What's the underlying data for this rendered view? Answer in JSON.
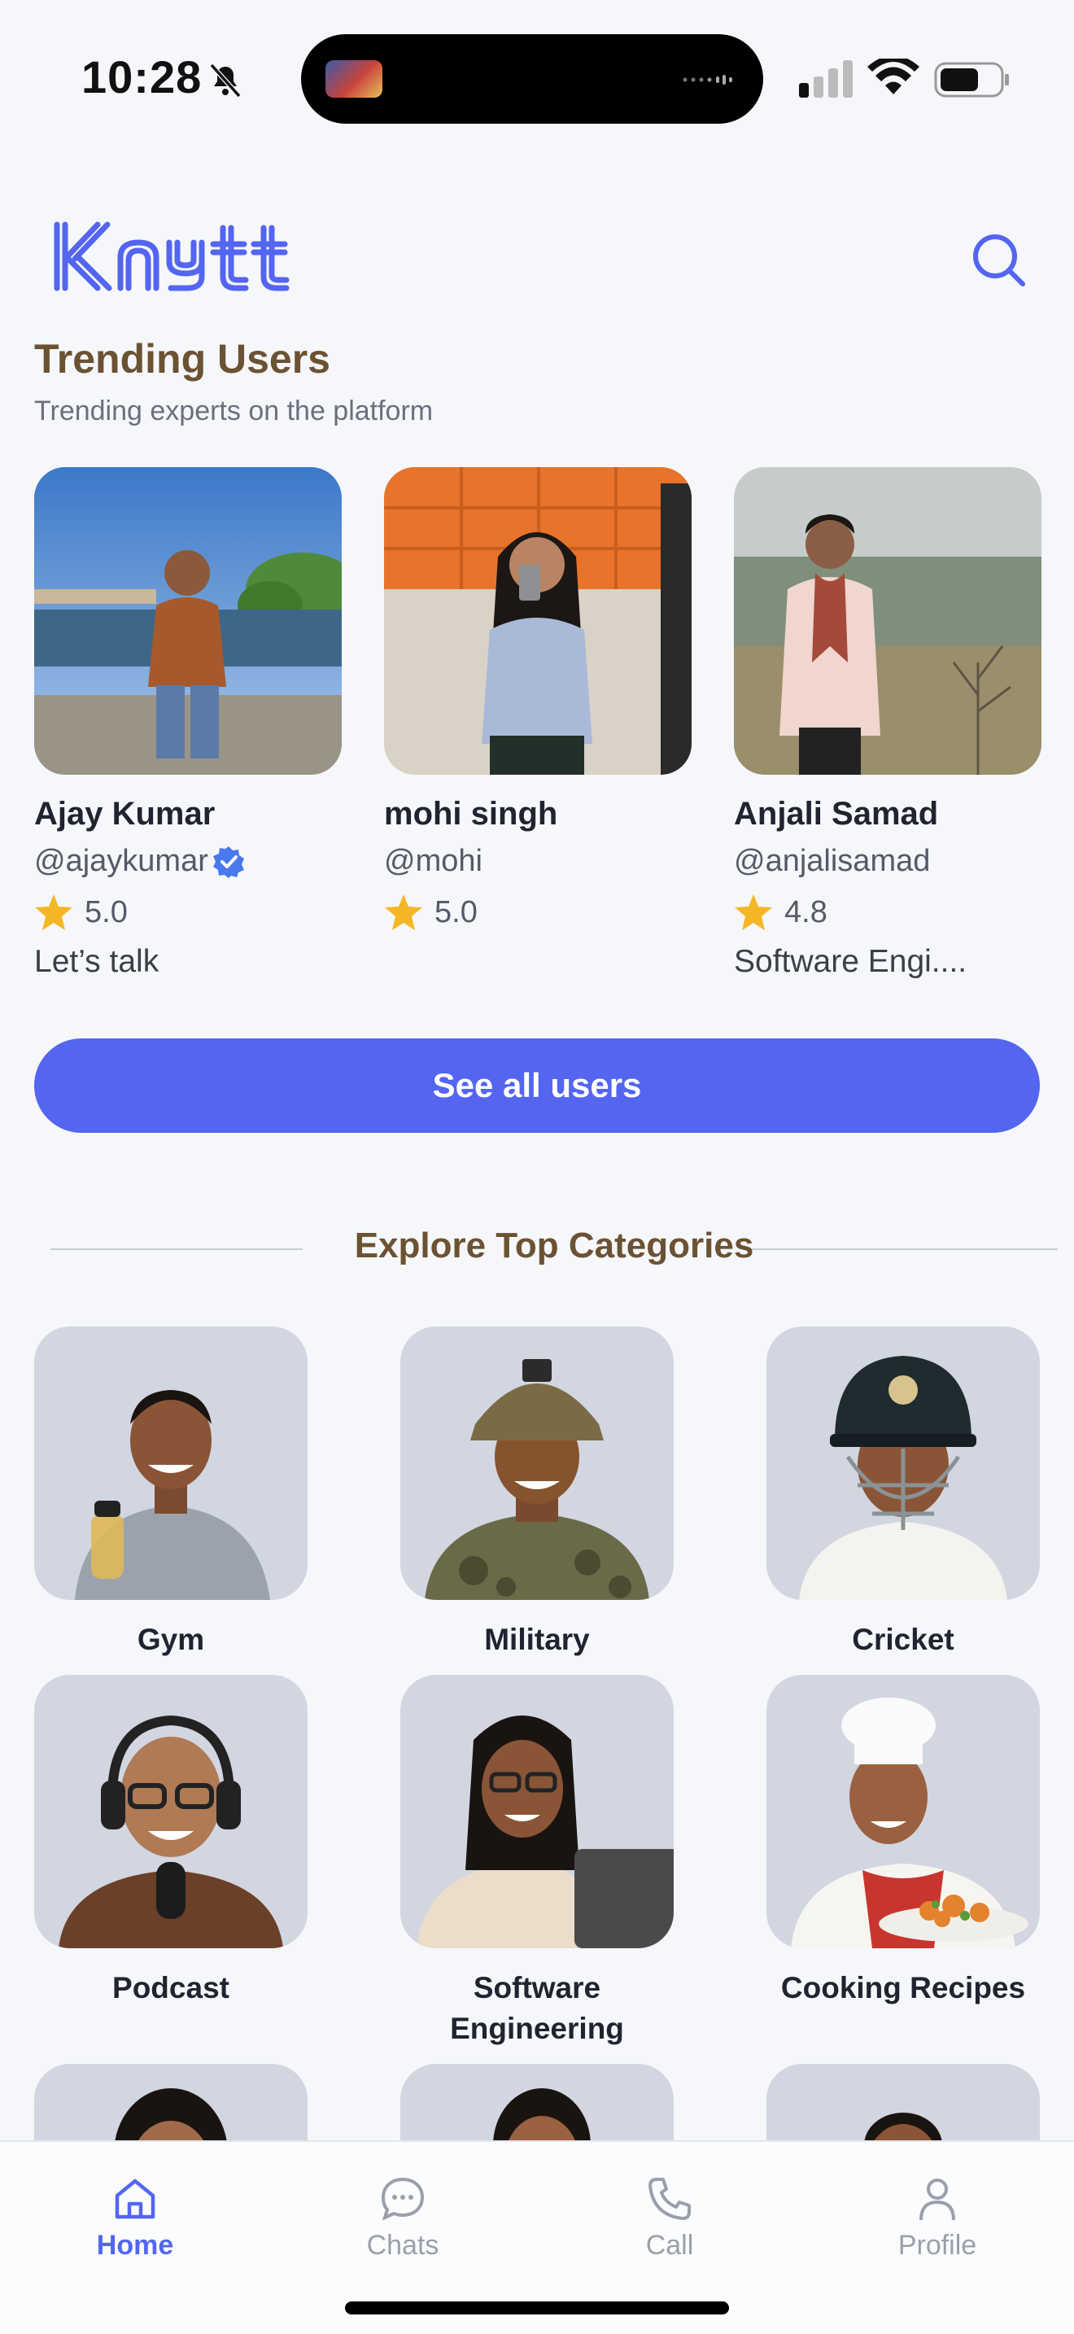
{
  "status_bar": {
    "time": "10:28"
  },
  "app": {
    "logo_text": "knytt",
    "accent": "#5465f0",
    "title_color": "#6b5232"
  },
  "trending": {
    "title": "Trending Users",
    "subtitle": "Trending experts on the platform",
    "users": [
      {
        "name": "Ajay Kumar",
        "handle": "@ajaykumar",
        "verified": true,
        "rating": "5.0",
        "bio": "Let’s talk"
      },
      {
        "name": "mohi singh",
        "handle": "@mohi",
        "verified": false,
        "rating": "5.0",
        "bio": ""
      },
      {
        "name": "Anjali Samad",
        "handle": "@anjalisamad",
        "verified": false,
        "rating": "4.8",
        "bio": "Software Engi...."
      }
    ],
    "see_all_label": "See all users"
  },
  "categories": {
    "title": "Explore Top Categories",
    "items": [
      {
        "label": "Gym"
      },
      {
        "label": "Military"
      },
      {
        "label": "Cricket"
      },
      {
        "label": "Podcast"
      },
      {
        "label": "Software Engineering"
      },
      {
        "label": "Cooking Recipes"
      },
      {
        "label": ""
      },
      {
        "label": ""
      },
      {
        "label": ""
      }
    ]
  },
  "tabbar": {
    "tabs": [
      {
        "label": "Home",
        "icon": "home-icon",
        "active": true
      },
      {
        "label": "Chats",
        "icon": "chat-icon",
        "active": false
      },
      {
        "label": "Call",
        "icon": "phone-icon",
        "active": false
      },
      {
        "label": "Profile",
        "icon": "profile-icon",
        "active": false
      }
    ]
  }
}
